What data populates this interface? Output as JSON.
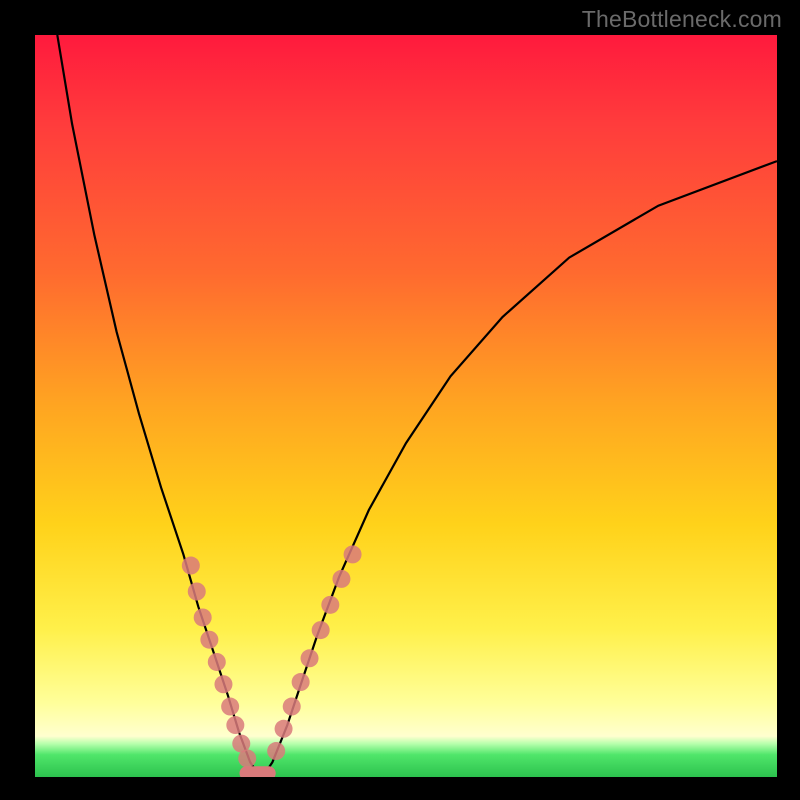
{
  "watermark": "TheBottleneck.com",
  "colors": {
    "dot": "#d97a7b",
    "curve": "#000000",
    "floor": "#d97a7b"
  },
  "chart_data": {
    "type": "line",
    "title": "",
    "xlabel": "",
    "ylabel": "",
    "xlim": [
      0,
      100
    ],
    "ylim": [
      0,
      100
    ],
    "series": [
      {
        "name": "bottleneck-curve",
        "x": [
          3,
          5,
          8,
          11,
          14,
          17,
          20,
          22,
          24,
          26,
          27.5,
          29,
          30,
          31,
          32,
          34,
          36,
          38,
          41,
          45,
          50,
          56,
          63,
          72,
          84,
          100
        ],
        "values": [
          100,
          88,
          73,
          60,
          49,
          39,
          30,
          23,
          17,
          11,
          6,
          2,
          0.5,
          0.5,
          2,
          7,
          13,
          19,
          27,
          36,
          45,
          54,
          62,
          70,
          77,
          83
        ]
      }
    ],
    "floor_segment": {
      "x_start": 28.5,
      "x_end": 31.5,
      "y": 0.5
    },
    "dots_left": [
      {
        "x": 21.0,
        "y": 28.5
      },
      {
        "x": 21.8,
        "y": 25.0
      },
      {
        "x": 22.6,
        "y": 21.5
      },
      {
        "x": 23.5,
        "y": 18.5
      },
      {
        "x": 24.5,
        "y": 15.5
      },
      {
        "x": 25.4,
        "y": 12.5
      },
      {
        "x": 26.3,
        "y": 9.5
      },
      {
        "x": 27.0,
        "y": 7.0
      },
      {
        "x": 27.8,
        "y": 4.5
      },
      {
        "x": 28.6,
        "y": 2.5
      }
    ],
    "dots_right": [
      {
        "x": 32.5,
        "y": 3.5
      },
      {
        "x": 33.5,
        "y": 6.5
      },
      {
        "x": 34.6,
        "y": 9.5
      },
      {
        "x": 35.8,
        "y": 12.8
      },
      {
        "x": 37.0,
        "y": 16.0
      },
      {
        "x": 38.5,
        "y": 19.8
      },
      {
        "x": 39.8,
        "y": 23.2
      },
      {
        "x": 41.3,
        "y": 26.7
      },
      {
        "x": 42.8,
        "y": 30.0
      }
    ]
  }
}
